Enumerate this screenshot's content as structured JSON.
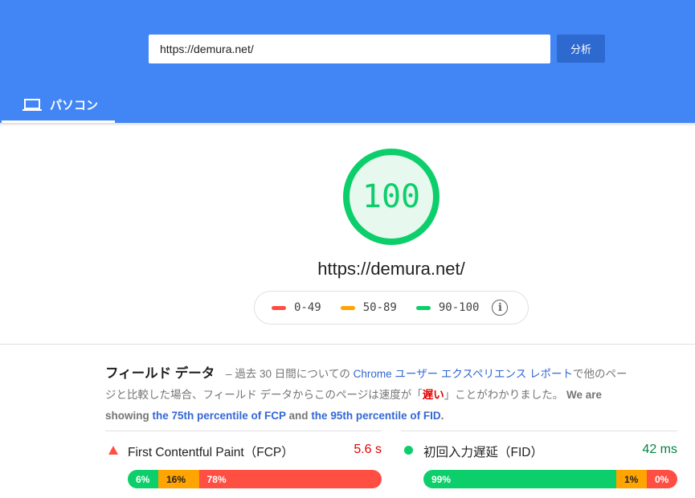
{
  "header": {
    "url_value": "https://demura.net/",
    "analyze_label": "分析",
    "tab_label": "パソコン"
  },
  "summary": {
    "score": "100",
    "url": "https://demura.net/",
    "legend": [
      {
        "range": "0-49",
        "color": "#ff4e42"
      },
      {
        "range": "50-89",
        "color": "#ffa400"
      },
      {
        "range": "90-100",
        "color": "#0cce6b"
      }
    ]
  },
  "field_data": {
    "title": "フィールド データ",
    "desc_1": " – 過去 30 日間についての ",
    "link_chrome": "Chrome ユーザー エクスペリエンス レポート",
    "desc_2": "で他のページと比較した場合、フィールド データからこのページは速度が「",
    "slow_word": "遅い",
    "desc_3": "」ことがわかりました。",
    "desc_4": " We are showing ",
    "link_fcp": "the 75th percentile of FCP",
    "desc_and": " and ",
    "link_fid": "the 95th percentile of FID",
    "desc_end": "."
  },
  "metrics": [
    {
      "name": "First Contentful Paint（FCP）",
      "value": "5.6 s",
      "value_color": "#e20000",
      "status_icon": "triangle-icon",
      "distribution": [
        {
          "label": "6%",
          "percent": 6,
          "class": "fast"
        },
        {
          "label": "16%",
          "percent": 16,
          "class": "avg"
        },
        {
          "label": "78%",
          "percent": 78,
          "class": "slow-seg"
        }
      ]
    },
    {
      "name": "初回入力遅延（FID）",
      "value": "42 ms",
      "value_color": "#018642",
      "status_icon": "circle-icon",
      "distribution": [
        {
          "label": "99%",
          "percent": 99,
          "class": "fast"
        },
        {
          "label": "1%",
          "percent": 1,
          "class": "avg"
        },
        {
          "label": "0%",
          "percent": 0,
          "class": "slow-seg"
        }
      ]
    }
  ]
}
